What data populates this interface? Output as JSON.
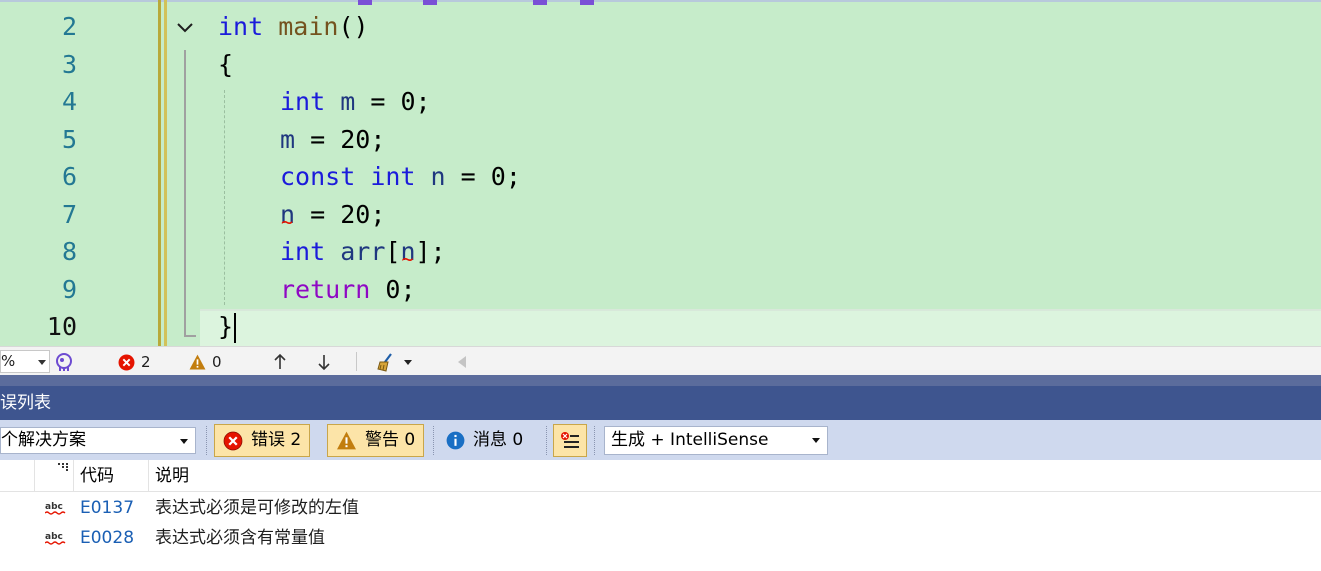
{
  "editor": {
    "line_numbers": [
      "2",
      "3",
      "4",
      "5",
      "6",
      "7",
      "8",
      "9",
      "10"
    ],
    "current_line": "10",
    "code": {
      "l2_kw": "int",
      "l2_fn": "main",
      "l2_rest": "()",
      "l3": "{",
      "l4_kw": "int",
      "l4_var": "m",
      "l4_op": " = ",
      "l4_num": "0",
      "l4_end": ";",
      "l5_var": "m",
      "l5_op": " = ",
      "l5_num": "20",
      "l5_end": ";",
      "l6_kw1": "const",
      "l6_kw2": "int",
      "l6_var": "n",
      "l6_op": " = ",
      "l6_num": "0",
      "l6_end": ";",
      "l7_var": "n",
      "l7_op": " = ",
      "l7_num": "20",
      "l7_end": ";",
      "l8_kw": "int",
      "l8_var": "arr",
      "l8_open": "[",
      "l8_idx": "n",
      "l8_close": "];",
      "l9_kw": "return",
      "l9_num": "0",
      "l9_end": ";",
      "l10": "}"
    },
    "colors": {
      "background": "#c6ecca",
      "keyword": "#1b1bdb",
      "return_keyword": "#8f08c4",
      "function": "#74531f",
      "variable": "#1f377f",
      "squiggle": "#e51400"
    }
  },
  "editor_status": {
    "zoom": "%",
    "error_count": "2",
    "warning_count": "0",
    "icons": [
      "intellicode-icon",
      "error-icon",
      "warning-icon",
      "arrow-up-icon",
      "arrow-down-icon",
      "broom-icon"
    ]
  },
  "error_list": {
    "header": "误列表",
    "scope": "个解决方案",
    "errors_btn": "错误 2",
    "warnings_btn": "警告 0",
    "messages_btn": "消息 0",
    "build_filter": "生成 + IntelliSense",
    "columns": {
      "code": "代码",
      "description": "说明"
    },
    "rows": [
      {
        "code": "E0137",
        "description": "表达式必须是可修改的左值"
      },
      {
        "code": "E0028",
        "description": "表达式必须含有常量值"
      }
    ],
    "colors": {
      "header_bg": "#3e558f",
      "toolbar_bg": "#cfd9ee",
      "button_active": "#fce4a8",
      "code_link": "#1a5fb4"
    }
  }
}
